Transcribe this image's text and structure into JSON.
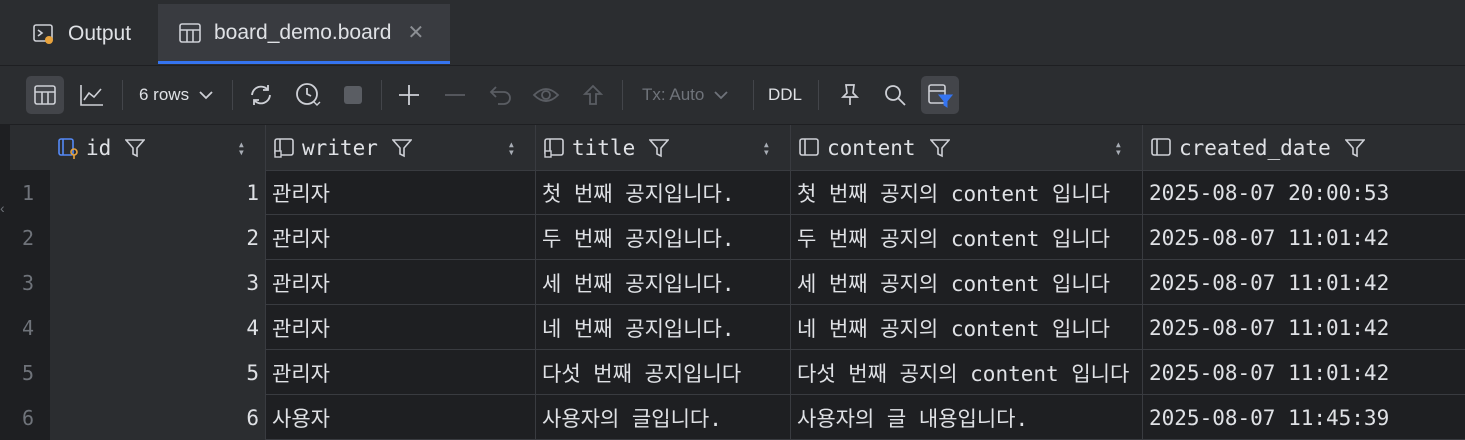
{
  "tabs": [
    {
      "label": "Output",
      "icon": "output-icon"
    },
    {
      "label": "board_demo.board",
      "icon": "table-icon",
      "active": true
    }
  ],
  "toolbar": {
    "rows_label": "6 rows",
    "tx_label": "Tx: Auto",
    "ddl_label": "DDL"
  },
  "columns": [
    {
      "name": "id",
      "icon": "primary-key-column-icon"
    },
    {
      "name": "writer",
      "icon": "column-icon"
    },
    {
      "name": "title",
      "icon": "column-icon"
    },
    {
      "name": "content",
      "icon": "column-icon"
    },
    {
      "name": "created_date",
      "icon": "column-icon"
    }
  ],
  "rows": [
    {
      "num": "1",
      "id": "1",
      "writer": "관리자",
      "title": "첫 번째 공지입니다.",
      "content": "첫 번째 공지의 content 입니다",
      "created_date": "2025-08-07 20:00:53"
    },
    {
      "num": "2",
      "id": "2",
      "writer": "관리자",
      "title": "두 번째 공지입니다.",
      "content": "두 번째 공지의 content 입니다",
      "created_date": "2025-08-07 11:01:42"
    },
    {
      "num": "3",
      "id": "3",
      "writer": "관리자",
      "title": "세 번째 공지입니다.",
      "content": "세 번째 공지의 content 입니다",
      "created_date": "2025-08-07 11:01:42"
    },
    {
      "num": "4",
      "id": "4",
      "writer": "관리자",
      "title": "네 번째 공지입니다.",
      "content": "네 번째 공지의 content 입니다",
      "created_date": "2025-08-07 11:01:42"
    },
    {
      "num": "5",
      "id": "5",
      "writer": "관리자",
      "title": "다섯 번째 공지입니다",
      "content": "다섯 번째 공지의 content 입니다",
      "created_date": "2025-08-07 11:01:42"
    },
    {
      "num": "6",
      "id": "6",
      "writer": "사용자",
      "title": "사용자의 글입니다.",
      "content": "사용자의 글 내용입니다.",
      "created_date": "2025-08-07 11:45:39"
    }
  ],
  "colors": {
    "background": "#1e1f22",
    "panel": "#2b2d30",
    "accent": "#3574f0",
    "filter_active": "#3574f0"
  }
}
